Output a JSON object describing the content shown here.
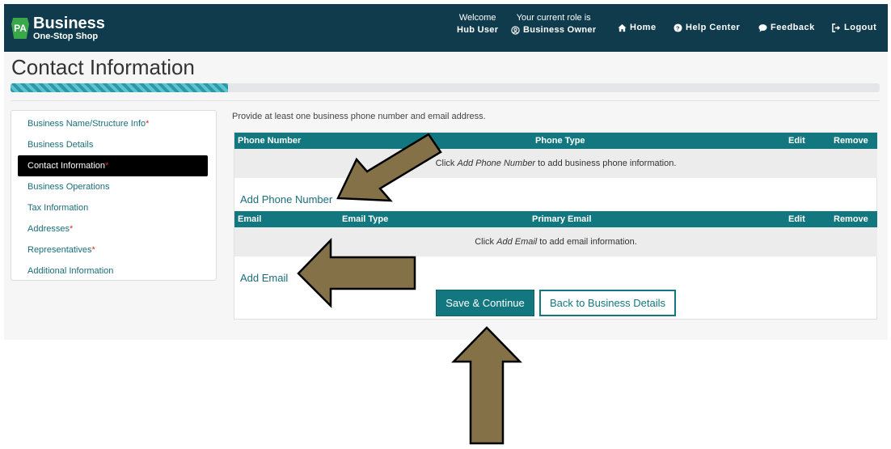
{
  "header": {
    "logo_badge": "PA",
    "logo_title": "Business",
    "logo_subtitle": "One-Stop Shop",
    "welcome_label": "Welcome",
    "welcome_user": "Hub User",
    "role_label": "Your current role is",
    "role_value": "Business Owner",
    "nav": [
      {
        "label": "Home",
        "icon": "home-icon"
      },
      {
        "label": "Help Center",
        "icon": "question-circle-icon"
      },
      {
        "label": "Feedback",
        "icon": "comment-icon"
      },
      {
        "label": "Logout",
        "icon": "logout-icon"
      }
    ]
  },
  "page": {
    "title": "Contact Information",
    "progress_fraction": 0.25
  },
  "sidebar": {
    "items": [
      {
        "label": "Business Name/Structure Info",
        "required": true,
        "active": false
      },
      {
        "label": "Business Details",
        "required": false,
        "active": false
      },
      {
        "label": "Contact Information",
        "required": true,
        "active": true
      },
      {
        "label": "Business Operations",
        "required": false,
        "active": false
      },
      {
        "label": "Tax Information",
        "required": false,
        "active": false
      },
      {
        "label": "Addresses",
        "required": true,
        "active": false
      },
      {
        "label": "Representatives",
        "required": true,
        "active": false
      },
      {
        "label": "Additional Information",
        "required": false,
        "active": false
      }
    ],
    "required_marker": "*"
  },
  "main": {
    "instructions": "Provide at least one business phone number and email address.",
    "phone_table": {
      "headers": [
        "Phone Number",
        "Phone Type",
        "Edit",
        "Remove"
      ],
      "empty_prefix": "Click ",
      "empty_em": "Add Phone Number",
      "empty_suffix": " to add business phone information."
    },
    "add_phone_label": "Add Phone Number",
    "email_table": {
      "headers": [
        "Email",
        "Email Type",
        "Primary Email",
        "Edit",
        "Remove"
      ],
      "empty_prefix": "Click ",
      "empty_em": "Add Email",
      "empty_suffix": " to add email information."
    },
    "add_email_label": "Add Email",
    "save_button": "Save & Continue",
    "back_button": "Back to Business Details"
  },
  "colors": {
    "header_bg": "#0f3b4c",
    "accent_teal": "#12777f",
    "link": "#1b6d7a",
    "arrow_fill": "#857148",
    "required": "#d0342c"
  }
}
